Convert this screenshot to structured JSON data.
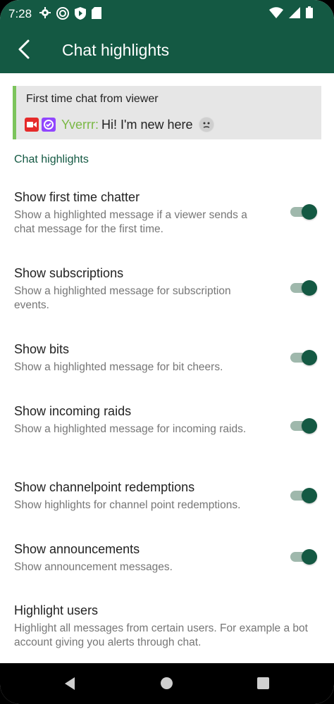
{
  "status": {
    "time": "7:28"
  },
  "appbar": {
    "title": "Chat highlights"
  },
  "preview": {
    "header": "First time chat from viewer",
    "username": "Yverrr:",
    "message": "Hi! I'm new here",
    "username_color": "#7ab845",
    "accent": "#7cc45c"
  },
  "section": {
    "title": "Chat highlights"
  },
  "settings": [
    {
      "title": "Show first time chatter",
      "subtitle": "Show a highlighted message if a viewer sends a chat message for the first time.",
      "enabled": true
    },
    {
      "title": "Show subscriptions",
      "subtitle": "Show a highlighted message for subscription events.",
      "enabled": true
    },
    {
      "title": "Show bits",
      "subtitle": "Show a highlighted message for bit cheers.",
      "enabled": true
    },
    {
      "title": "Show incoming raids",
      "subtitle": "Show a highlighted message for incoming raids.",
      "enabled": true
    },
    {
      "title": "Show channelpoint redemptions",
      "subtitle": "Show highlights for channel point redemptions.",
      "enabled": true
    },
    {
      "title": "Show announcements",
      "subtitle": "Show announcement messages.",
      "enabled": true
    },
    {
      "title": "Highlight users",
      "subtitle": "Highlight all messages from certain users. For example a bot account giving you alerts through chat."
    }
  ],
  "theme": {
    "primary": "#145943"
  }
}
